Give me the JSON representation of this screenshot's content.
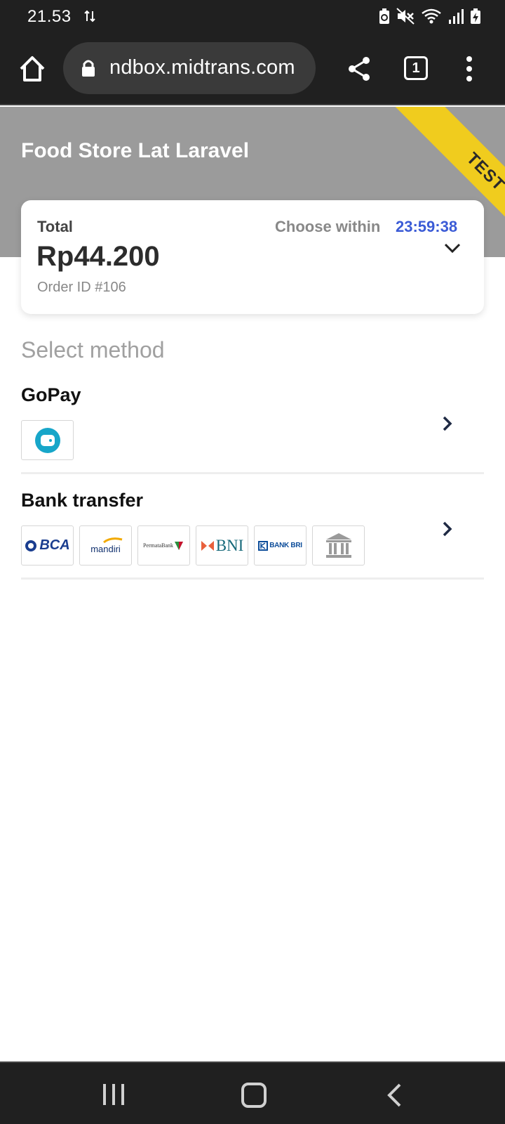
{
  "status_bar": {
    "time": "21.53"
  },
  "browser": {
    "url": "ndbox.midtrans.com",
    "tab_count": "1"
  },
  "header": {
    "store_name": "Food Store Lat Laravel",
    "ribbon": "TEST"
  },
  "summary": {
    "total_label": "Total",
    "choose_within_label": "Choose within",
    "countdown": "23:59:38",
    "amount": "Rp44.200",
    "order_id": "Order ID #106"
  },
  "methods": {
    "heading": "Select method",
    "gopay": {
      "title": "GoPay"
    },
    "bank_transfer": {
      "title": "Bank transfer",
      "banks": {
        "bca": "BCA",
        "mandiri": "mandiri",
        "permata": "PermataBank",
        "bni": "BNI",
        "bri": "BANK BRI"
      }
    }
  },
  "colors": {
    "header_gray": "#9b9b9b",
    "ribbon_yellow": "#f0cc1e",
    "countdown_blue": "#3b5bd6",
    "gopay_teal": "#17a6c9"
  },
  "icons": [
    "data-arrows-icon",
    "battery-saver-icon",
    "mute-icon",
    "wifi-icon",
    "signal-icon",
    "battery-charging-icon",
    "home-icon",
    "lock-icon",
    "share-icon",
    "tabs-icon",
    "more-vert-icon",
    "chevron-down-icon",
    "chevron-right-icon",
    "wallet-icon",
    "bank-building-icon",
    "recents-icon",
    "nav-home-icon",
    "back-icon"
  ]
}
